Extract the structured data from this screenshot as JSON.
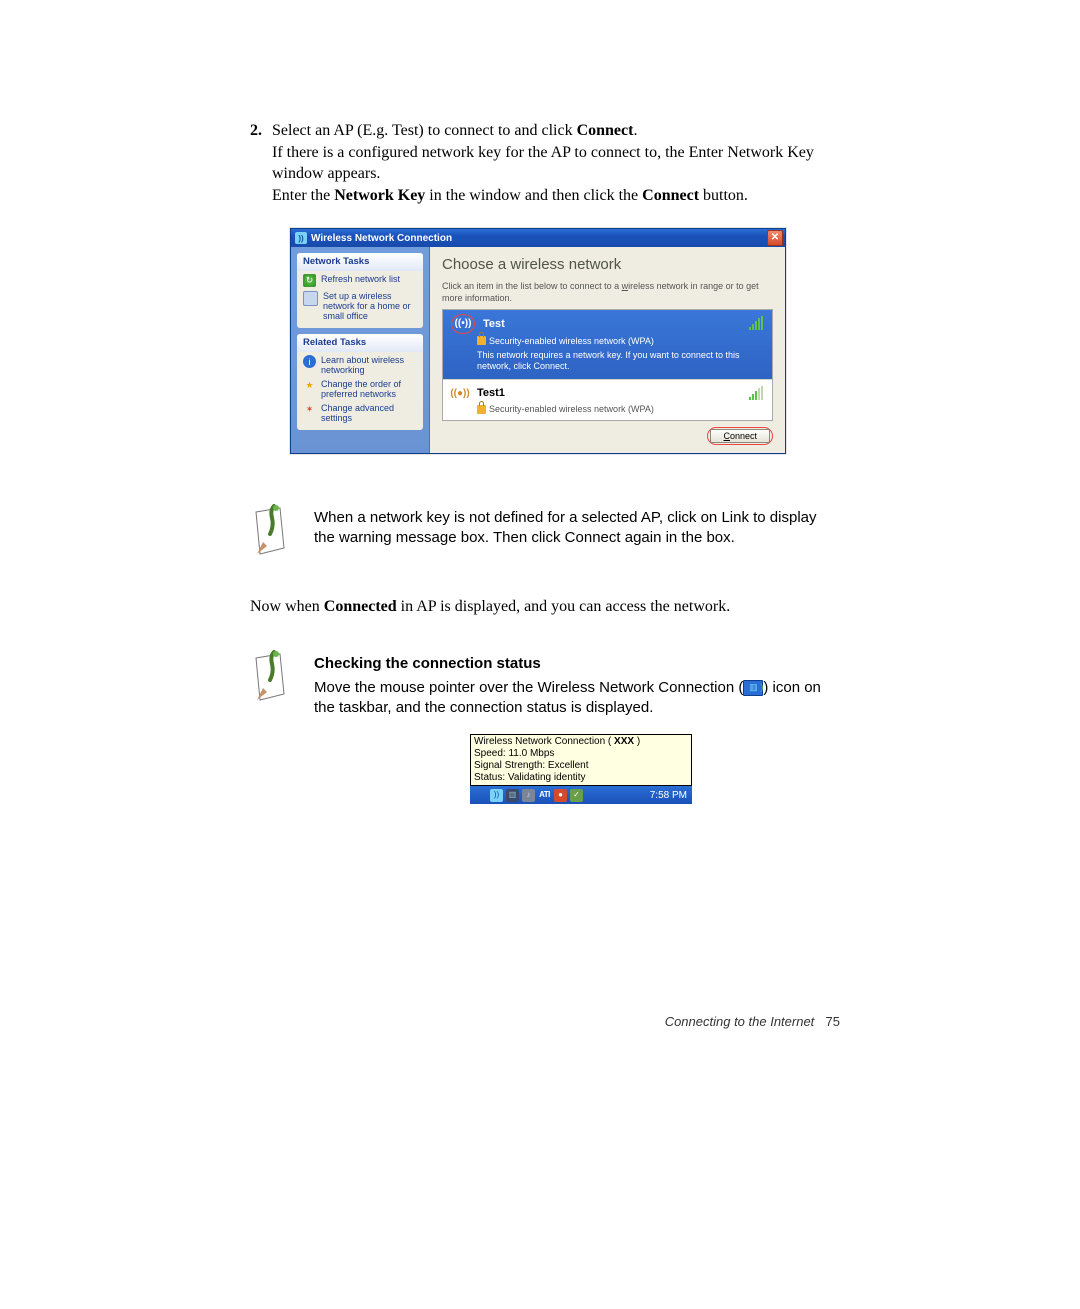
{
  "step": {
    "number": "2.",
    "t1a": "Select an AP (E.g. Test) to connect to and click ",
    "t1b": "Connect",
    "t1c": ".",
    "t2": "If there is a configured network key for the AP to connect to, the Enter Network Key window appears.",
    "t3a": "Enter the ",
    "t3b": "Network Key",
    "t3c": " in the window and then click the ",
    "t3d": "Connect",
    "t3e": " button."
  },
  "window": {
    "title": "Wireless Network Connection",
    "close": "✕",
    "sidebar": {
      "group1": {
        "header": "Network Tasks",
        "items": [
          {
            "label": "Refresh network list"
          },
          {
            "label": "Set up a wireless network for a home or small office"
          }
        ]
      },
      "group2": {
        "header": "Related Tasks",
        "items": [
          {
            "label": "Learn about wireless networking"
          },
          {
            "label": "Change the order of preferred networks"
          },
          {
            "label": "Change advanced settings"
          }
        ]
      }
    },
    "main": {
      "heading": "Choose a wireless network",
      "sub1": "Click an item in the list below to connect to a ",
      "sub_u": "w",
      "sub2": "ireless network in range or to get more information.",
      "networks": [
        {
          "name": "Test",
          "security": "Security-enabled wireless network (WPA)",
          "desc": "This network requires a network key. If you want to connect to this network, click Connect.",
          "selected": true
        },
        {
          "name": "Test1",
          "security": "Security-enabled wireless network (WPA)",
          "selected": false
        }
      ],
      "connect_u": "C",
      "connect_rest": "onnect"
    }
  },
  "note1": "When a network key is not defined for a selected AP, click on Link to display the warning message box. Then click Connect again in the box.",
  "line2a": "Now when ",
  "line2b": "Connected",
  "line2c": " in AP is displayed, and you can access the network.",
  "note2": {
    "heading": "Checking the connection status",
    "t1": "Move the mouse pointer over the Wireless Network Connection (",
    "t2": ") icon on the taskbar, and the connection status is displayed."
  },
  "tooltip": {
    "line1a": "Wireless Network Connection (  ",
    "line1b": "XXX",
    "line1c": "  )",
    "line2": "Speed: 11.0 Mbps",
    "line3": "Signal Strength: Excellent",
    "line4": "Status: Validating identity"
  },
  "tray": {
    "ati": "ATI",
    "clock": "7:58 PM"
  },
  "footer": {
    "text": "Connecting to the Internet",
    "page": "75"
  }
}
